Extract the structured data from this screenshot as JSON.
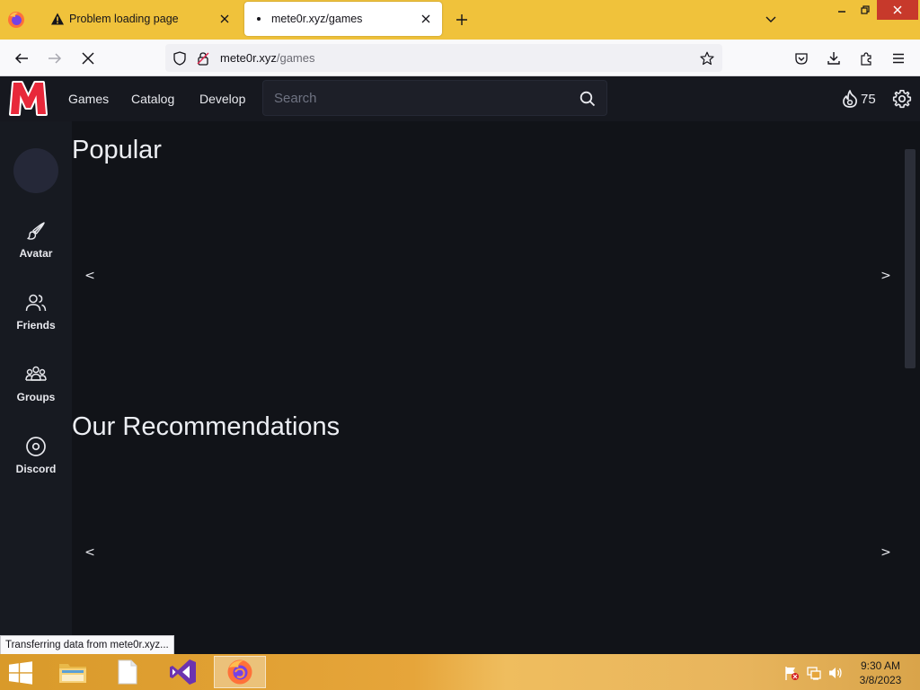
{
  "browser": {
    "tabs": [
      {
        "label": "Problem loading page",
        "icon": "warning-icon",
        "active": false
      },
      {
        "label": "mete0r.xyz/games",
        "icon": "loading-dot-icon",
        "active": true
      }
    ],
    "url": {
      "host": "mete0r.xyz",
      "path": "/games"
    },
    "status_text": "Transferring data from mete0r.xyz..."
  },
  "site": {
    "brand_color": "#e8283a",
    "logo_letter": "M",
    "nav": [
      "Games",
      "Catalog",
      "Develop"
    ],
    "search_placeholder": "Search",
    "currency_amount": "75"
  },
  "sidebar": {
    "items": [
      {
        "label": "Avatar",
        "icon": "paintbrush-icon"
      },
      {
        "label": "Friends",
        "icon": "friends-icon"
      },
      {
        "label": "Groups",
        "icon": "groups-icon"
      },
      {
        "label": "Discord",
        "icon": "discord-icon"
      }
    ]
  },
  "sections": [
    {
      "title": "Popular",
      "prev": "<",
      "next": ">"
    },
    {
      "title": "Our Recommendations",
      "prev": "<",
      "next": ">"
    }
  ],
  "taskbar": {
    "apps": [
      "file-explorer-icon",
      "notepad-icon",
      "visual-studio-icon",
      "firefox-icon"
    ],
    "time": "9:30 AM",
    "date": "3/8/2023"
  }
}
